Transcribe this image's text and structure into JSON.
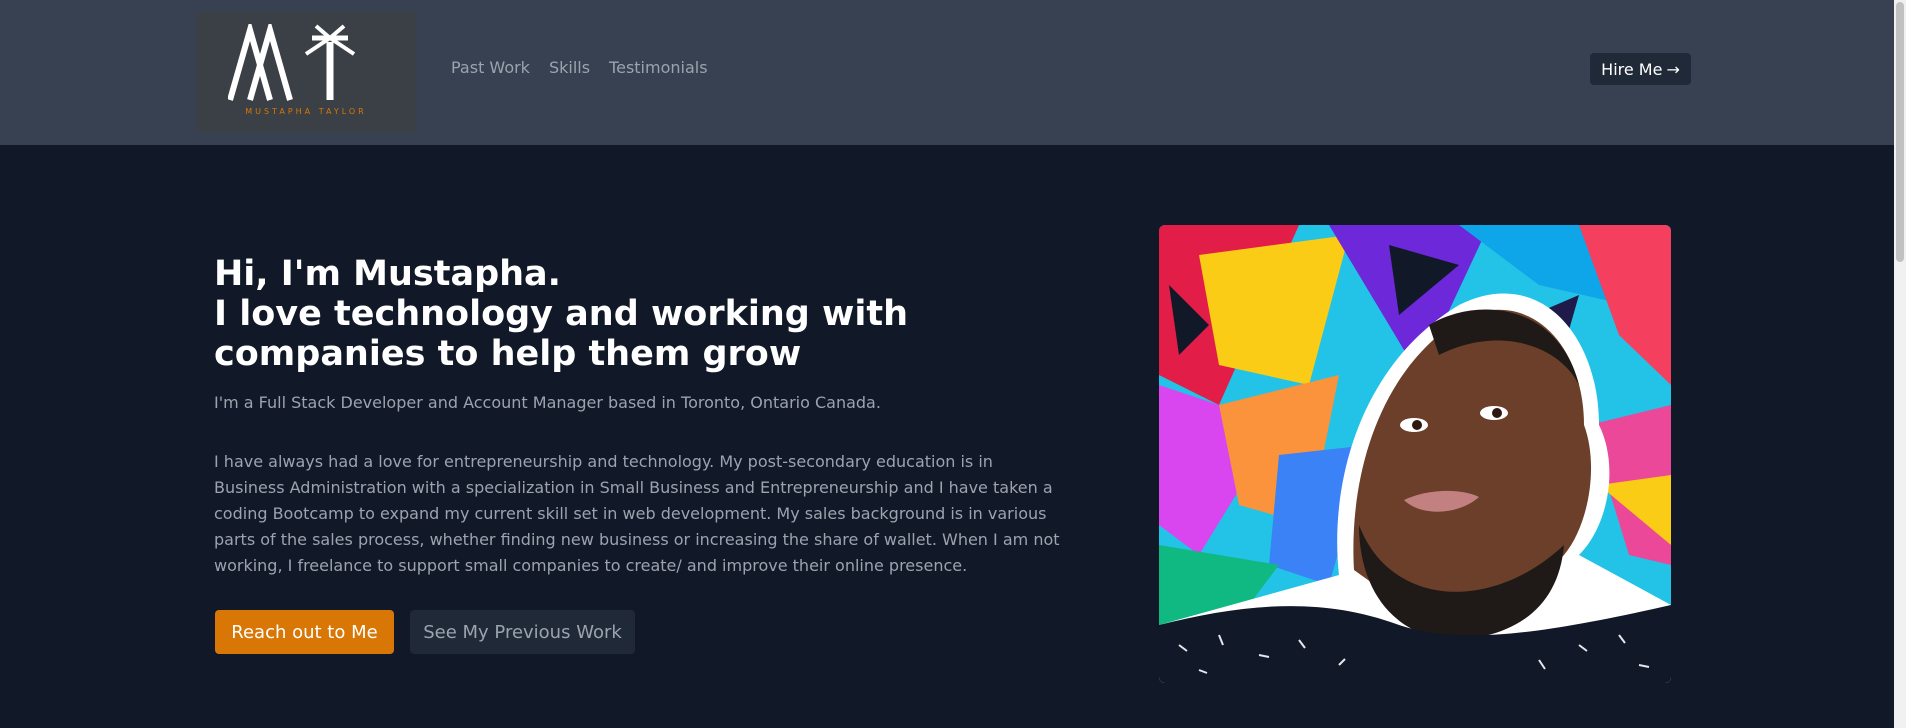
{
  "header": {
    "logo": {
      "monogram": "MT",
      "name": "MUSTAPHA TAYLOR"
    },
    "nav": [
      "Past Work",
      "Skills",
      "Testimonials"
    ],
    "hire_button": {
      "label": "Hire Me",
      "icon": "arrow-right-icon"
    }
  },
  "hero": {
    "title_line1": "Hi, I'm Mustapha.",
    "title_line2": "I love technology and working with companies to help them grow",
    "subtitle": "I'm a Full Stack Developer and Account Manager based in Toronto, Ontario Canada.",
    "paragraph": "I have always had a love for entrepreneurship and technology. My post-secondary education is in Business Administration with a specialization in Small Business and Entrepreneurship and I have taken a coding Bootcamp to expand my current skill set in web development. My sales background is in various parts of the sales process, whether finding new business or increasing the share of wallet. When I am not working, I freelance to support small companies to create/ and improve their online presence.",
    "primary_button": "Reach out to Me",
    "secondary_button": "See My Previous Work"
  },
  "colors": {
    "header_bg": "#374151",
    "page_bg": "#111827",
    "accent": "#d97706",
    "muted_text": "#9ca3af"
  }
}
